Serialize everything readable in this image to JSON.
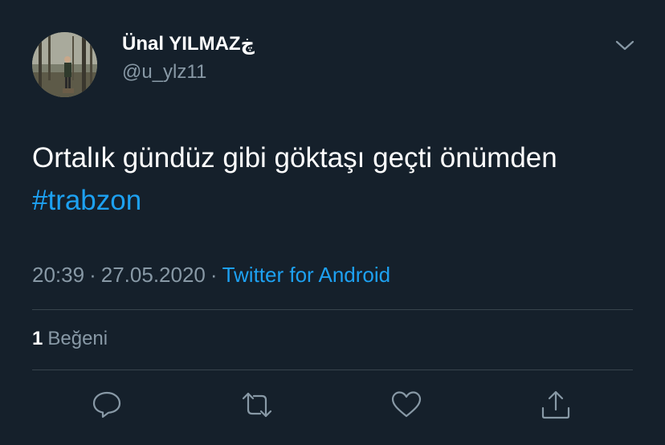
{
  "author": {
    "display_name": "Ünal YILMAZ",
    "name_emoji": "ڿ",
    "handle": "@u_ylz11"
  },
  "tweet": {
    "text": "Ortalık gündüz gibi göktaşı geçti önümden",
    "hashtag": "#trabzon"
  },
  "meta": {
    "time": "20:39",
    "separator": "·",
    "date": "27.05.2020",
    "source": "Twitter for Android"
  },
  "stats": {
    "likes_count": "1",
    "likes_label": "Beğeni"
  },
  "actions": [
    {
      "icon": "reply-icon"
    },
    {
      "icon": "retweet-icon"
    },
    {
      "icon": "like-icon"
    },
    {
      "icon": "share-icon"
    }
  ],
  "colors": {
    "background": "#15202b",
    "accent": "#1da1f2",
    "secondary_text": "#8899a6",
    "divider": "#38444d"
  }
}
